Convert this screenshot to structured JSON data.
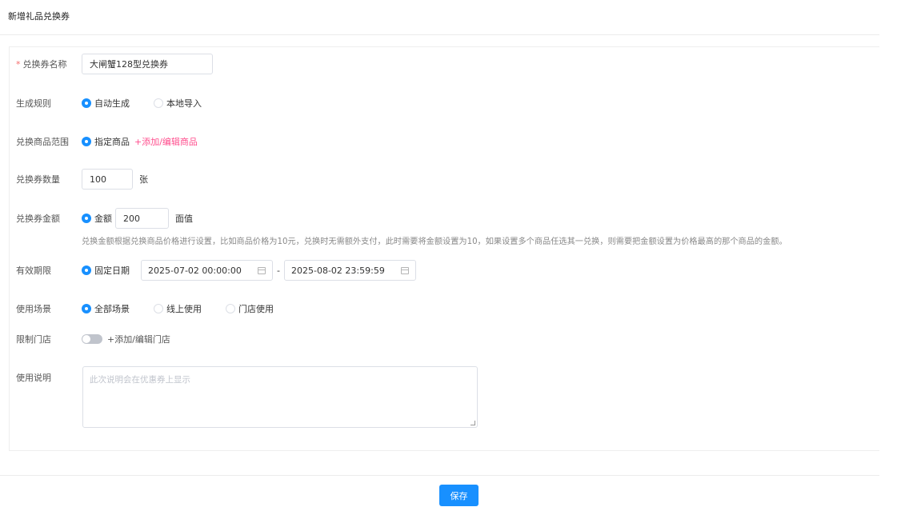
{
  "page": {
    "title": "新增礼品兑换券"
  },
  "form": {
    "name": {
      "label": "兑换券名称",
      "required_mark": "*",
      "value": "大闸蟹128型兑换券"
    },
    "rule": {
      "label": "生成规则",
      "options": [
        "自动生成",
        "本地导入"
      ],
      "selected": "自动生成"
    },
    "scope": {
      "label": "兑换商品范围",
      "option": "指定商品",
      "link": "+添加/编辑商品"
    },
    "quantity": {
      "label": "兑换券数量",
      "value": "100",
      "unit": "张"
    },
    "amount": {
      "label": "兑换券金额",
      "option": "金额",
      "value": "200",
      "unit": "面值",
      "hint": "兑换金额根据兑换商品价格进行设置，比如商品价格为10元，兑换时无需额外支付，此时需要将金额设置为10，如果设置多个商品任选其一兑换，则需要把金额设置为价格最高的那个商品的金额。"
    },
    "validity": {
      "label": "有效期限",
      "option": "固定日期",
      "start": "2025-07-02 00:00:00",
      "separator": "-",
      "end": "2025-08-02 23:59:59"
    },
    "usage": {
      "label": "使用场景",
      "options": [
        "全部场景",
        "线上使用",
        "门店使用"
      ],
      "selected": "全部场景"
    },
    "store_limit": {
      "label": "限制门店",
      "enabled": false,
      "link": "+添加/编辑门店"
    },
    "description": {
      "label": "使用说明",
      "placeholder": "此次说明会在优惠券上显示",
      "value": ""
    }
  },
  "footer": {
    "save_label": "保存"
  },
  "colors": {
    "primary": "#1890ff",
    "link_pink": "#ff4d8d",
    "required": "#f56c6c"
  }
}
